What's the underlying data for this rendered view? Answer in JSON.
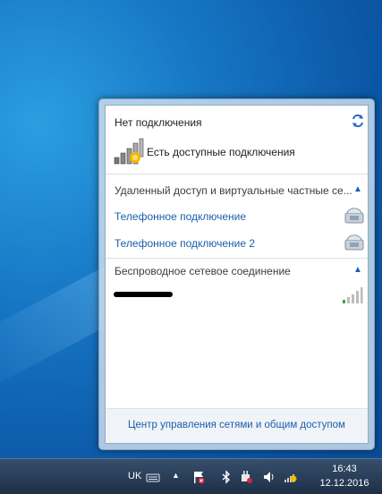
{
  "flyout": {
    "status_title": "Нет подключения",
    "available_text": "Есть доступные подключения",
    "vpn_section": {
      "header": "Удаленный доступ и виртуальные частные се...",
      "items": [
        {
          "label": "Телефонное подключение"
        },
        {
          "label": "Телефонное подключение 2"
        }
      ]
    },
    "wireless_section": {
      "header": "Беспроводное сетевое соединение",
      "network_name": ""
    },
    "footer_link": "Центр управления сетями и общим доступом"
  },
  "taskbar": {
    "language": "UK",
    "time": "16:43",
    "date": "12.12.2016"
  },
  "icons": {
    "refresh": "refresh-icon",
    "signal": "signal-warning-icon",
    "dialup": "dialup-phone-icon",
    "wifi": "wifi-signal-icon"
  },
  "colors": {
    "link": "#1b5fa8",
    "warning": "#f5b800",
    "signal_green": "#34a853"
  }
}
